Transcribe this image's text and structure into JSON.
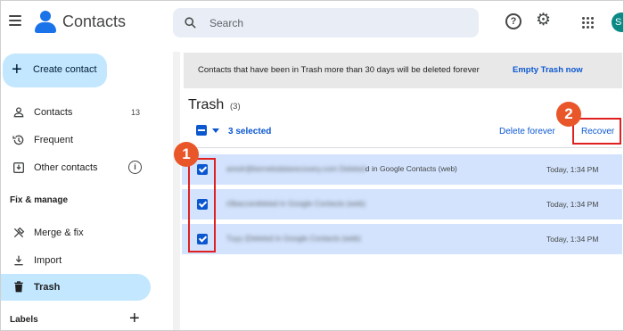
{
  "header": {
    "app_title": "Contacts",
    "search_placeholder": "Search",
    "avatar_initial": "S"
  },
  "sidebar": {
    "create_label": "Create contact",
    "items": [
      {
        "label": "Contacts",
        "count": "13",
        "icon": "person-icon"
      },
      {
        "label": "Frequent",
        "icon": "history-icon"
      },
      {
        "label": "Other contacts",
        "icon": "inbox-download-icon"
      }
    ],
    "fix_title": "Fix & manage",
    "fix_items": [
      {
        "label": "Merge & fix",
        "icon": "tools-icon"
      },
      {
        "label": "Import",
        "icon": "download-icon"
      },
      {
        "label": "Trash",
        "icon": "trash-icon",
        "active": true
      }
    ],
    "labels_title": "Labels"
  },
  "banner": {
    "message": "Contacts that have been in Trash more than 30 days will be deleted forever",
    "action": "Empty Trash now"
  },
  "trash": {
    "title": "Trash",
    "count": "(3)",
    "selected_label": "3 selected",
    "delete_forever": "Delete forever",
    "recover": "Recover",
    "rows": [
      {
        "blurred": "amolr@kernelsdatarecovery.com Deleted",
        "suffix": "d in Google Contacts (web)",
        "date": "Today, 1:34 PM"
      },
      {
        "blurred": "r0baccenkleted in Google Contacts (web)",
        "suffix": "",
        "date": "Today, 1:34 PM"
      },
      {
        "blurred": "Tuyy (Deleted in Google Contacts (web)",
        "suffix": "",
        "date": "Today, 1:34 PM"
      }
    ]
  },
  "annotations": {
    "step1": "1",
    "step2": "2",
    "color": "#e8562a"
  }
}
